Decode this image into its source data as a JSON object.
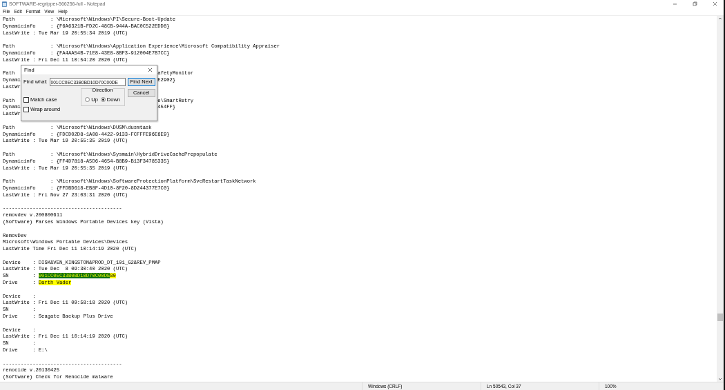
{
  "window": {
    "title": "SOFTWARE-regripper-566256-full - Notepad"
  },
  "menu": [
    "File",
    "Edit",
    "Format",
    "View",
    "Help"
  ],
  "editor": {
    "lines": [
      {
        "kind": "text",
        "text": "Path            : \\Microsoft\\Windows\\PI\\Secure-Boot-Update"
      },
      {
        "kind": "text",
        "text": "Dynamicinfo     : {F6A6321B-FD2C-48CB-944A-BAC0C522EDD8}"
      },
      {
        "kind": "text",
        "text": "LastWrite : Tue Mar 19 20:55:34 2019 (UTC)"
      },
      {
        "kind": "blank"
      },
      {
        "kind": "text",
        "text": "Path            : \\Microsoft\\Windows\\Application Experience\\Microsoft Compatibility Appraiser"
      },
      {
        "kind": "text",
        "text": "Dynamicinfo     : {FA4AA54B-71E8-43E8-8BF3-912004E7B7CC}"
      },
      {
        "kind": "text",
        "text": "LastWrite : Fri Dec 11 10:54:20 2020 (UTC)"
      },
      {
        "kind": "blank"
      },
      {
        "kind": "split",
        "left": "Path",
        "right": "afetyMonitor"
      },
      {
        "kind": "split",
        "left": "Dynami",
        "right": "E2902}"
      },
      {
        "kind": "split",
        "left": "LastWr"
      },
      {
        "kind": "blank"
      },
      {
        "kind": "split",
        "left": "Path",
        "right": "e\\SmartRetry"
      },
      {
        "kind": "split",
        "left": "Dynami",
        "right": "454FF}"
      },
      {
        "kind": "split",
        "left": "LastWr"
      },
      {
        "kind": "blank"
      },
      {
        "kind": "text",
        "text": "Path            : \\Microsoft\\Windows\\DUSM\\dusmtask"
      },
      {
        "kind": "text",
        "text": "Dynamicinfo     : {FDCD02D8-1A08-4422-9133-FCFFFE96E6E9}"
      },
      {
        "kind": "text",
        "text": "LastWrite : Tue Mar 19 20:55:35 2019 (UTC)"
      },
      {
        "kind": "blank"
      },
      {
        "kind": "text",
        "text": "Path            : \\Microsoft\\Windows\\Sysmain\\HybridDriveCachePrepopulate"
      },
      {
        "kind": "text",
        "text": "Dynamicinfo     : {FF4D7818-A5D6-4654-B8B9-B13F34785335}"
      },
      {
        "kind": "text",
        "text": "LastWrite : Tue Mar 19 20:55:35 2019 (UTC)"
      },
      {
        "kind": "blank"
      },
      {
        "kind": "text",
        "text": "Path            : \\Microsoft\\Windows\\SoftwareProtectionPlatform\\SvcRestartTaskNetwork"
      },
      {
        "kind": "text",
        "text": "Dynamicinfo     : {FFDBD618-EB8F-4D10-8F20-8D244377E7C0}"
      },
      {
        "kind": "text",
        "text": "LastWrite : Fri Nov 27 23:03:31 2020 (UTC)"
      },
      {
        "kind": "blank"
      },
      {
        "kind": "text",
        "text": "----------------------------------------"
      },
      {
        "kind": "text",
        "text": "removdev v.200800611"
      },
      {
        "kind": "text",
        "text": "(Software) Parses Windows Portable Devices key (Vista)"
      },
      {
        "kind": "blank"
      },
      {
        "kind": "text",
        "text": "RemovDev"
      },
      {
        "kind": "text",
        "text": "Microsoft\\Windows Portable Devices\\Devices"
      },
      {
        "kind": "text",
        "text": "LastWrite Time Fri Dec 11 10:14:19 2020 (UTC)"
      },
      {
        "kind": "blank"
      },
      {
        "kind": "text",
        "text": "Device    : DISK&VEN_KINGSTON&PROD_DT_101_G2&REV_PMAP"
      },
      {
        "kind": "text",
        "text": "LastWrite : Tue Dec  8 09:30:40 2020 (UTC)"
      },
      {
        "kind": "segments",
        "segments": [
          {
            "text": "SN        : "
          },
          {
            "text": "001CC0EC33B0BD10D70C00DE",
            "selected": true,
            "highlight": true
          },
          {
            "text": "80",
            "highlight": true
          }
        ]
      },
      {
        "kind": "segments",
        "segments": [
          {
            "text": "Drive     : "
          },
          {
            "text": "Darth Vader",
            "highlight": true
          }
        ]
      },
      {
        "kind": "blank"
      },
      {
        "kind": "text",
        "text": "Device    :"
      },
      {
        "kind": "text",
        "text": "LastWrite : Fri Dec 11 09:58:18 2020 (UTC)"
      },
      {
        "kind": "text",
        "text": "SN        :"
      },
      {
        "kind": "text",
        "text": "Drive     : Seagate Backup Plus Drive"
      },
      {
        "kind": "blank"
      },
      {
        "kind": "text",
        "text": "Device    :"
      },
      {
        "kind": "text",
        "text": "LastWrite : Fri Dec 11 10:14:19 2020 (UTC)"
      },
      {
        "kind": "text",
        "text": "SN        :"
      },
      {
        "kind": "text",
        "text": "Drive     : E:\\"
      },
      {
        "kind": "blank"
      },
      {
        "kind": "text",
        "text": "----------------------------------------"
      },
      {
        "kind": "text",
        "text": "renocide v.20130425"
      },
      {
        "kind": "text",
        "text": "(Software) Check for Renocide malware"
      }
    ]
  },
  "find_dialog": {
    "title": "Find",
    "find_what_label": "Find what:",
    "find_what_value": "001CC0EC33B0BD10D70C00DE",
    "buttons": [
      {
        "label": "Find Next",
        "default": true
      },
      {
        "label": "Cancel",
        "default": false
      }
    ],
    "direction": {
      "label": "Direction",
      "options": [
        {
          "label": "Up",
          "selected": false
        },
        {
          "label": "Down",
          "selected": true
        }
      ]
    },
    "checkboxes": [
      {
        "label": "Match case",
        "checked": false
      },
      {
        "label": "Wrap around",
        "checked": false
      }
    ]
  },
  "status_bar": [
    "Windows (CRLF)",
    "Ln 50543, Col 37",
    "100%"
  ]
}
